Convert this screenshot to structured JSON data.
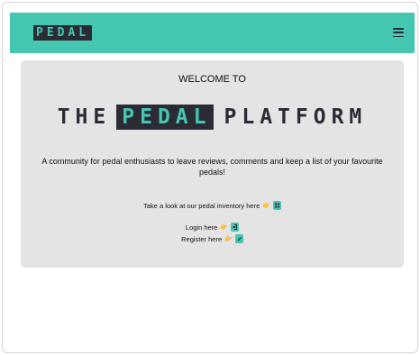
{
  "brand": {
    "logo_text": "PEDAL"
  },
  "hero": {
    "welcome": "WELCOME TO",
    "title_the": "THE",
    "title_pedal": "PEDAL",
    "title_platform": "PLATFORM",
    "tagline": "A community for pedal enthusiasts to leave reviews, comments and keep a list of your favourite pedals!"
  },
  "links": {
    "inventory_label": "Take a look at our pedal inventory here",
    "login_label": "Login here",
    "register_label": "Register here",
    "pointer": "👉"
  },
  "icons": {
    "menu": "hamburger-icon",
    "inventory": "grid-icon",
    "login": "login-icon",
    "register": "pencil-icon"
  },
  "colors": {
    "accent": "#45c6b1",
    "dark": "#2b2b36",
    "card": "#e4e4e4"
  }
}
